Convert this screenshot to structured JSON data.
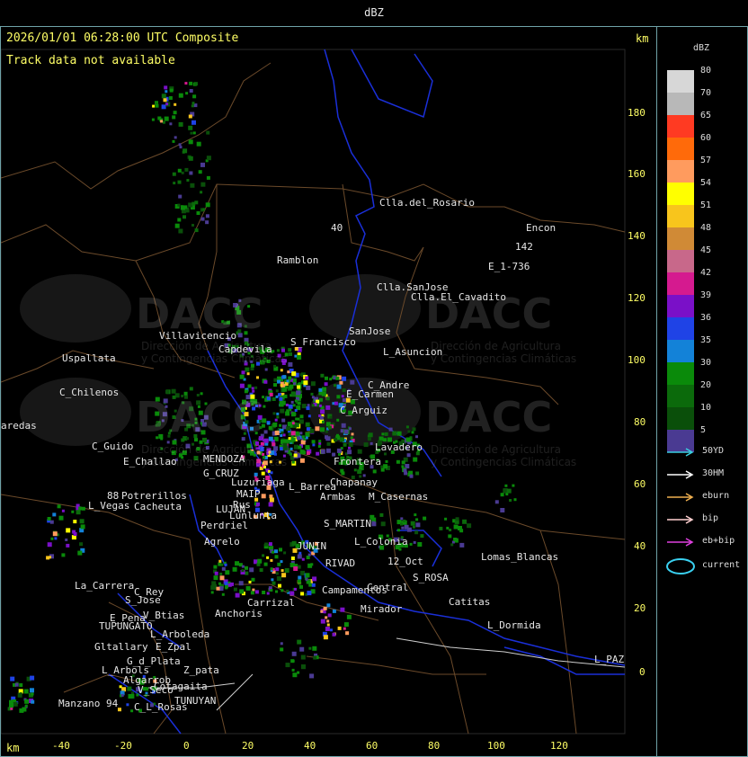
{
  "window": {
    "title": "dBZ"
  },
  "map": {
    "header": "2026/01/01 06:28:00 UTC Composite",
    "notice": "Track data not available",
    "unit": "km",
    "y_ticks": [
      "180",
      "160",
      "140",
      "120",
      "100",
      "80",
      "60",
      "40",
      "20",
      "0"
    ],
    "x_ticks": [
      "-40",
      "-20",
      "0",
      "20",
      "40",
      "60",
      "80",
      "100",
      "120"
    ],
    "watermark": {
      "logo": "DACC",
      "line1": "Dirección de Agricultura",
      "line2": "y Contingencias Climáticas"
    },
    "places": [
      {
        "id": "clla-rosario",
        "label": "Clla.del_Rosario"
      },
      {
        "id": "encon",
        "label": "Encon"
      },
      {
        "id": "r142",
        "label": "142"
      },
      {
        "id": "e1736",
        "label": "E_1-736"
      },
      {
        "id": "ramblon",
        "label": "Ramblon"
      },
      {
        "id": "r40",
        "label": "40"
      },
      {
        "id": "clla-sanjose",
        "label": "Clla.SanJose"
      },
      {
        "id": "clla-elcavadito",
        "label": "Clla.El_Cavadito"
      },
      {
        "id": "villavicencio",
        "label": "Villavicencio"
      },
      {
        "id": "sanjose",
        "label": "SanJose"
      },
      {
        "id": "s-francisco",
        "label": "S_Francisco"
      },
      {
        "id": "capdevila",
        "label": "Capdevila"
      },
      {
        "id": "l-asuncion",
        "label": "L_Asuncion"
      },
      {
        "id": "uspallata",
        "label": "Uspallata"
      },
      {
        "id": "c-andre",
        "label": "C_Andre"
      },
      {
        "id": "e-carmen",
        "label": "E_Carmen"
      },
      {
        "id": "c-chilenos",
        "label": "C_Chilenos"
      },
      {
        "id": "c-arguiz",
        "label": "C_Arguiz"
      },
      {
        "id": "paredas",
        "label": "aredas"
      },
      {
        "id": "lavadero",
        "label": "Lavadero"
      },
      {
        "id": "c-guido",
        "label": "C_Guido"
      },
      {
        "id": "e-challao",
        "label": "E_Challao"
      },
      {
        "id": "mendoza",
        "label": "MENDOZA"
      },
      {
        "id": "g-cruz",
        "label": "G_CRUZ"
      },
      {
        "id": "frontera",
        "label": "Frontera"
      },
      {
        "id": "luzuriaga",
        "label": "Luzuriaga"
      },
      {
        "id": "l-barrea",
        "label": "L_Barrea"
      },
      {
        "id": "chapanay",
        "label": "Chapanay"
      },
      {
        "id": "r88",
        "label": "88"
      },
      {
        "id": "potrerillos",
        "label": "Potrerillos"
      },
      {
        "id": "maip",
        "label": "MAIP"
      },
      {
        "id": "rus",
        "label": "Rus"
      },
      {
        "id": "armbas",
        "label": "Armbas"
      },
      {
        "id": "m-casernas",
        "label": "M_Casernas"
      },
      {
        "id": "l-vegas",
        "label": "L_Vegas"
      },
      {
        "id": "cacheuta",
        "label": "Cacheuta"
      },
      {
        "id": "lujan",
        "label": "LUJAN"
      },
      {
        "id": "lunlunta",
        "label": "Lunlunta"
      },
      {
        "id": "perdriel",
        "label": "Perdriel"
      },
      {
        "id": "s-martin",
        "label": "S_MARTIN"
      },
      {
        "id": "agrelo",
        "label": "Agrelo"
      },
      {
        "id": "junin",
        "label": "JUNIN"
      },
      {
        "id": "rivadavia",
        "label": "L_Colonia"
      },
      {
        "id": "lomas-blancas",
        "label": "Lomas_Blancas"
      },
      {
        "id": "rivad",
        "label": "RIVAD"
      },
      {
        "id": "l2oct",
        "label": "12_Oct"
      },
      {
        "id": "s-rosa",
        "label": "S_ROSA"
      },
      {
        "id": "la-carrera",
        "label": "La_Carrera"
      },
      {
        "id": "c-rey",
        "label": "C_Rey"
      },
      {
        "id": "s-jose",
        "label": "S_Jose"
      },
      {
        "id": "campamentos",
        "label": "Campamentos"
      },
      {
        "id": "central",
        "label": "Central"
      },
      {
        "id": "catitas",
        "label": "Catitas"
      },
      {
        "id": "carrizal",
        "label": "Carrizal"
      },
      {
        "id": "v-btias",
        "label": "V_Btias"
      },
      {
        "id": "anchoris",
        "label": "Anchoris"
      },
      {
        "id": "e-pena",
        "label": "E_Pena"
      },
      {
        "id": "tupungato",
        "label": "TUPUNGATO"
      },
      {
        "id": "mirador",
        "label": "Mirador"
      },
      {
        "id": "l-dormida",
        "label": "L_Dormida"
      },
      {
        "id": "l-arboleda",
        "label": "L_Arboleda"
      },
      {
        "id": "gltallary",
        "label": "Gltallary"
      },
      {
        "id": "e-zpal",
        "label": "E_Zpal"
      },
      {
        "id": "la-paz",
        "label": "L_PAZ"
      },
      {
        "id": "g-d-plata",
        "label": "G_d_Plata"
      },
      {
        "id": "l-arbols",
        "label": "L_Arbols"
      },
      {
        "id": "zpata",
        "label": "Z_pata"
      },
      {
        "id": "algarrob",
        "label": "Algarrob"
      },
      {
        "id": "v-seco",
        "label": "V_Seco"
      },
      {
        "id": "manzano",
        "label": "Manzano"
      },
      {
        "id": "r94",
        "label": "94"
      },
      {
        "id": "tunuyan",
        "label": "TUNUYAN"
      },
      {
        "id": "l-rosas",
        "label": "C_L_Rosas"
      },
      {
        "id": "cotagaita",
        "label": "Cotagaita"
      }
    ]
  },
  "legend": {
    "title": "dBZ",
    "scale": [
      {
        "label": "80",
        "color": "#d7d7d7"
      },
      {
        "label": "70",
        "color": "#b8b8b8"
      },
      {
        "label": "65",
        "color": "#ff3a22"
      },
      {
        "label": "60",
        "color": "#ff6a0a"
      },
      {
        "label": "57",
        "color": "#ff9b5e"
      },
      {
        "label": "54",
        "color": "#ffff00"
      },
      {
        "label": "51",
        "color": "#f8c51c"
      },
      {
        "label": "48",
        "color": "#d08a36"
      },
      {
        "label": "45",
        "color": "#c8688a"
      },
      {
        "label": "42",
        "color": "#d51a8f"
      },
      {
        "label": "39",
        "color": "#7a10c8"
      },
      {
        "label": "36",
        "color": "#1f43e6"
      },
      {
        "label": "35",
        "color": "#1382d8"
      },
      {
        "label": "30",
        "color": "#0a8a0a"
      },
      {
        "label": "20",
        "color": "#0b6a0b"
      },
      {
        "label": "10",
        "color": "#0a4f0a"
      },
      {
        "label": "5",
        "color": "#4a3a92"
      }
    ],
    "tracks": [
      {
        "label": "50YD",
        "color": "#3ad0e0"
      },
      {
        "label": "30HM",
        "color": "#ffffff"
      },
      {
        "label": "eburn",
        "color": "#f0b050"
      },
      {
        "label": "bip",
        "color": "#ffd0d0"
      },
      {
        "label": "eb+bip",
        "color": "#e040e0"
      }
    ],
    "current_label": "current",
    "current_color": "#3ad0f0"
  }
}
